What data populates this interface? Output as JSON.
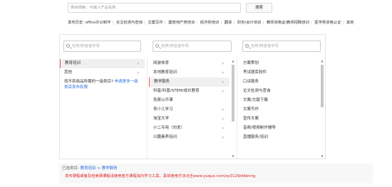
{
  "search": {
    "placeholder": "类目搜索：可输入产品名称",
    "button_label": "搜索"
  },
  "history": {
    "label": "发布历史:",
    "items": [
      "office办公制作",
      "论文检测与查询",
      "文案写作",
      "建筑地产类培训",
      "经济师培训",
      "翻译",
      "财务/会计培训",
      "教师资格证/教师招聘培训",
      "医学类资格认证",
      "其他"
    ]
  },
  "columns": {
    "col1": {
      "search_placeholder": "名称/拼音首字母",
      "items": [
        {
          "label": "教育培训",
          "has_children": true
        },
        {
          "label": "其他",
          "has_children": true
        }
      ],
      "hint_text": "找不到商品所属的一级类目? 申请更多一级类目发布权限",
      "hint_link": "申请更多一级类目发布权限"
    },
    "col2": {
      "search_placeholder": "名称/拼音首字母",
      "items": [
        {
          "label": "网游体育",
          "has_children": true
        },
        {
          "label": "本地教育培训",
          "has_children": true
        },
        {
          "label": "教学服务",
          "has_children": true
        },
        {
          "label": "科普/科普/STEM/成长教育",
          "has_children": true
        },
        {
          "label": "免费公开课",
          "has_children": false
        },
        {
          "label": "青少儿学习",
          "has_children": true
        },
        {
          "label": "淘宝大学",
          "has_children": true
        },
        {
          "label": "小二专用（勿发）",
          "has_children": true
        },
        {
          "label": "兴趣素养培训",
          "has_children": true
        }
      ]
    },
    "col3": {
      "search_placeholder": "名称/拼音首字母",
      "items": [
        {
          "label": "方案策划"
        },
        {
          "label": "考试题库软件"
        },
        {
          "label": "口译服务"
        },
        {
          "label": "论文检测与查询"
        },
        {
          "label": "文案/文献下载"
        },
        {
          "label": "文案写作"
        },
        {
          "label": "宣传文案"
        },
        {
          "label": "音频/视频制作辅导"
        },
        {
          "label": "直播服务/培训"
        }
      ]
    }
  },
  "footer": {
    "selected_label": "已选类目:",
    "selected_path": "教育培训 > 教学服务",
    "notice": "发布课程或者及检索课课程请使用官方课程淘内学习工具，具体使用方法点击www.yuque.com/oy3129/dbbnng"
  },
  "colors": {
    "accent_red": "#e02020",
    "link_blue": "#2a6fdb",
    "selected_bg": "#f0f0f0"
  }
}
